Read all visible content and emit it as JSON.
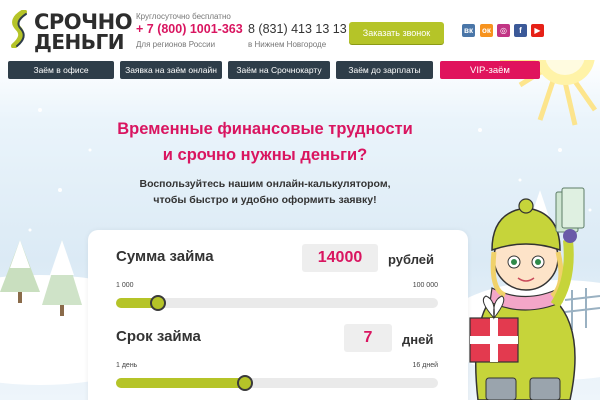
{
  "brand": {
    "line1": "СРОЧНО",
    "line2": "ДЕНЬГИ"
  },
  "header": {
    "hours_note": "Круглосуточно бесплатно",
    "phone_free": "+ 7 (800) 1001-363",
    "phone_free_note": "Для регионов России",
    "phone_local": "8 (831) 413 13 13",
    "phone_local_note": "в Нижнем Новгороде",
    "callback_label": "Заказать звонок",
    "social": [
      {
        "icon": "vk-icon",
        "glyph": "вк",
        "color": "#4a76a8"
      },
      {
        "icon": "odnoklassniki-icon",
        "glyph": "ок",
        "color": "#f7931e"
      },
      {
        "icon": "instagram-icon",
        "glyph": "◎",
        "color": "#c13584"
      },
      {
        "icon": "facebook-icon",
        "glyph": "f",
        "color": "#3b5998"
      },
      {
        "icon": "youtube-icon",
        "glyph": "▶",
        "color": "#e62117"
      }
    ]
  },
  "nav": [
    {
      "label": "Заём в офисе"
    },
    {
      "label": "Заявка на заём онлайн"
    },
    {
      "label": "Заём на Срочнокарту"
    },
    {
      "label": "Заём до зарплаты"
    },
    {
      "label": "VIP-заём"
    }
  ],
  "hero": {
    "title_line1": "Временные финансовые трудности",
    "title_line2": "и срочно нужны деньги?",
    "sub_line1": "Воспользуйтесь нашим онлайн-калькулятором,",
    "sub_line2": "чтобы быстро и удобно оформить заявку!"
  },
  "calculator": {
    "amount": {
      "label": "Сумма займа",
      "value": "14000",
      "unit": "рублей",
      "min_label": "1 000",
      "max_label": "100 000",
      "level": 0.13
    },
    "term": {
      "label": "Срок займа",
      "value": "7",
      "unit": "дней",
      "min_label": "1 день",
      "max_label": "16 дней",
      "level": 0.4
    }
  },
  "colors": {
    "accent": "#d91560",
    "green": "#b5c428",
    "nav": "#2e3d49"
  }
}
